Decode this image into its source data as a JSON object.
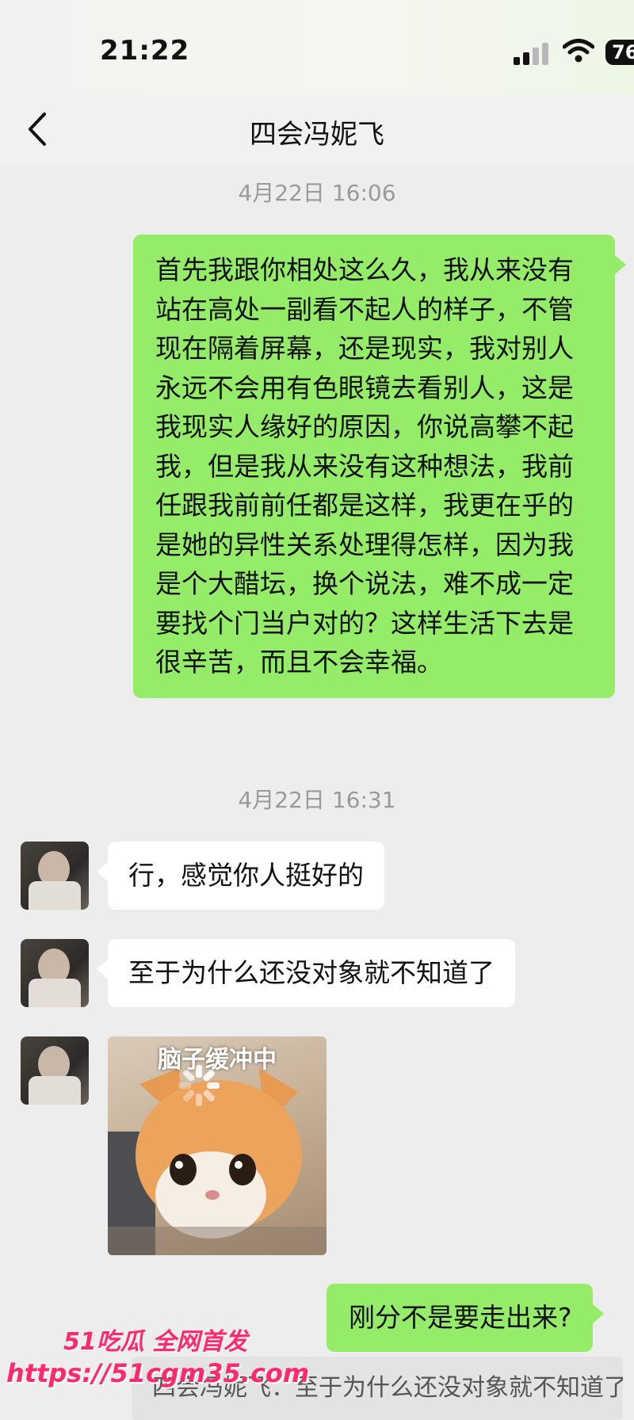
{
  "status_bar": {
    "time": "21:22",
    "battery": "76"
  },
  "header": {
    "title": "四会冯妮飞",
    "back_icon": "chevron-left-icon"
  },
  "messages": [
    {
      "type": "timestamp",
      "text": "4月22日 16:06"
    },
    {
      "type": "sent",
      "text": "首先我跟你相处这么久，我从来没有站在高处一副看不起人的样子，不管现在隔着屏幕，还是现实，我对别人永远不会用有色眼镜去看别人，这是我现实人缘好的原因，你说高攀不起我，但是我从来没有这种想法，我前任跟我前前任都是这样，我更在乎的是她的异性关系处理得怎样，因为我是个大醋坛，换个说法，难不成一定要找个门当户对的？这样生活下去是很辛苦，而且不会幸福。"
    },
    {
      "type": "timestamp",
      "text": "4月22日 16:31"
    },
    {
      "type": "received",
      "text": "行，感觉你人挺好的"
    },
    {
      "type": "received",
      "text": "至于为什么还没对象就不知道了"
    },
    {
      "type": "received_sticker",
      "caption": "脑子缓冲中"
    },
    {
      "type": "sent",
      "text": "刚分不是要走出来?"
    }
  ],
  "quote": {
    "text": "四会冯妮飞：至于为什么还没对象就不知道了"
  },
  "watermark": {
    "brand": "51吃瓜 全网首发",
    "url": "https://51cgm35.com"
  },
  "colors": {
    "sent_bubble": "#95ec69",
    "received_bubble": "#ffffff",
    "background": "#ededed",
    "watermark": "#ff2a6d"
  }
}
